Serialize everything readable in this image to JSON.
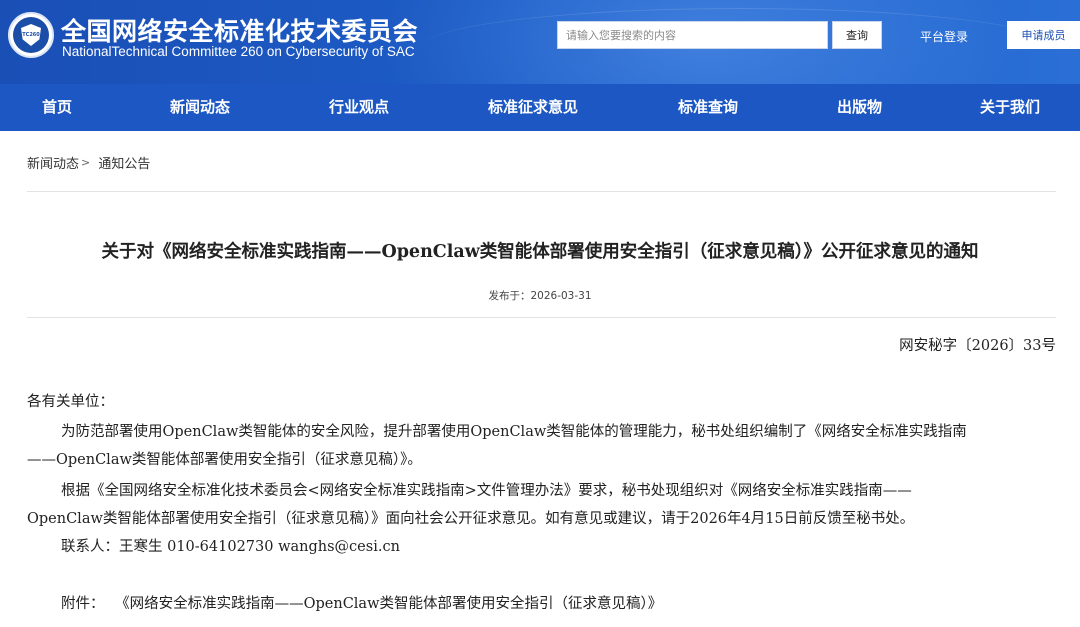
{
  "header": {
    "site_title": "全国网络安全标准化技术委员会",
    "site_subtitle": "NationalTechnical Committee 260 on Cybersecurity of SAC",
    "logo_text": "TC260",
    "search_placeholder": "请输入您要搜索的内容",
    "search_button": "查询",
    "login_label": "平台登录",
    "apply_label": "申请成员"
  },
  "nav": {
    "items": [
      "首页",
      "新闻动态",
      "行业观点",
      "标准征求意见",
      "标准查询",
      "出版物",
      "关于我们"
    ]
  },
  "breadcrumb": {
    "items": [
      "新闻动态",
      "通知公告"
    ],
    "separator": ">"
  },
  "article": {
    "title": "关于对《网络安全标准实践指南——OpenClaw类智能体部署使用安全指引（征求意见稿）》公开征求意见的通知",
    "publish_label": "发布于：2026-03-31",
    "doc_number": "网安秘字〔2026〕33号",
    "salutation": "各有关单位：",
    "para1_line1": "为防范部署使用OpenClaw类智能体的安全风险，提升部署使用OpenClaw类智能体的管理能力，秘书处组织编制了《网络安全标准实践指南",
    "para1_line2": "——OpenClaw类智能体部署使用安全指引（征求意见稿）》。",
    "para2_line1": "根据《全国网络安全标准化技术委员会<网络安全标准实践指南>文件管理办法》要求，秘书处现组织对《网络安全标准实践指南——",
    "para2_line2": "OpenClaw类智能体部署使用安全指引（征求意见稿）》面向社会公开征求意见。如有意见或建议，请于2026年4月15日前反馈至秘书处。",
    "contact": "联系人：王寒生 010-64102730 wanghs@cesi.cn",
    "attachment_label": "附件：",
    "attachment_link": "《网络安全标准实践指南——OpenClaw类智能体部署使用安全指引（征求意见稿）》"
  },
  "colors": {
    "header_blue": "#1a4fb6",
    "nav_blue": "#1c57c3"
  }
}
